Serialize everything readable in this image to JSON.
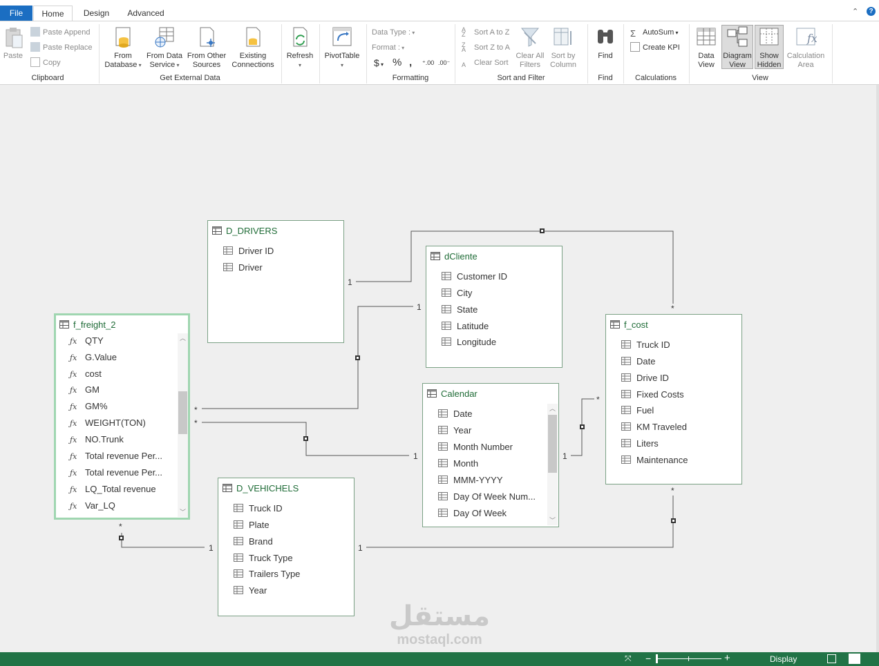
{
  "tabs": {
    "file": "File",
    "home": "Home",
    "design": "Design",
    "advanced": "Advanced"
  },
  "ribbon": {
    "clipboard": {
      "paste": "Paste",
      "paste_append": "Paste Append",
      "paste_replace": "Paste Replace",
      "copy": "Copy",
      "group": "Clipboard"
    },
    "external": {
      "from_database_1": "From",
      "from_database_2": "Database",
      "from_data_service_1": "From Data",
      "from_data_service_2": "Service",
      "from_other_1": "From Other",
      "from_other_2": "Sources",
      "existing_1": "Existing",
      "existing_2": "Connections",
      "group": "Get External Data"
    },
    "refresh": {
      "label": "Refresh"
    },
    "pivot": {
      "label": "PivotTable"
    },
    "formatting": {
      "data_type": "Data Type :",
      "format": "Format :",
      "dollar": "$",
      "percent": "%",
      "comma": "ͱ",
      "group": "Formatting"
    },
    "sort": {
      "sort_az": "Sort A to Z",
      "sort_za": "Sort Z to A",
      "clear_sort": "Clear Sort",
      "clear_filters_1": "Clear All",
      "clear_filters_2": "Filters",
      "sort_by_col_1": "Sort by",
      "sort_by_col_2": "Column",
      "group": "Sort and Filter"
    },
    "find": {
      "label": "Find",
      "group": "Find"
    },
    "calculations": {
      "autosum": "AutoSum",
      "create_kpi": "Create KPI",
      "group": "Calculations"
    },
    "view": {
      "data_view_1": "Data",
      "data_view_2": "View",
      "diagram_view_1": "Diagram",
      "diagram_view_2": "View",
      "show_hidden_1": "Show",
      "show_hidden_2": "Hidden",
      "calc_area_1": "Calculation",
      "calc_area_2": "Area",
      "group": "View"
    }
  },
  "tables": {
    "d_drivers": {
      "title": "D_DRIVERS",
      "fields": [
        "Driver ID",
        "Driver"
      ]
    },
    "dcliente": {
      "title": "dCliente",
      "fields": [
        "Customer ID",
        "City",
        "State",
        "Latitude",
        "Longitude"
      ]
    },
    "f_freight_2": {
      "title": "f_freight_2",
      "fields": [
        "QTY",
        "G.Value",
        "cost",
        "GM",
        "GM%",
        "WEIGHT(TON)",
        "NO.Trunk",
        "Total revenue Per...",
        "Total revenue Per...",
        "LQ_Total revenue",
        "Var_LQ"
      ]
    },
    "f_cost": {
      "title": "f_cost",
      "fields": [
        "Truck ID",
        "Date",
        "Drive ID",
        "Fixed Costs",
        "Fuel",
        "KM Traveled",
        "Liters",
        "Maintenance"
      ]
    },
    "calendar": {
      "title": "Calendar",
      "fields": [
        "Date",
        "Year",
        "Month Number",
        "Month",
        "MMM-YYYY",
        "Day Of Week Num...",
        "Day Of Week"
      ]
    },
    "d_vehichels": {
      "title": "D_VEHICHELS",
      "fields": [
        "Truck ID",
        "Plate",
        "Brand",
        "Truck Type",
        "Trailers Type",
        "Year"
      ]
    }
  },
  "cardinality": {
    "one": "1",
    "many": "*"
  },
  "watermark": {
    "arabic": "مستقل",
    "latin": "mostaql.com"
  },
  "status": {
    "display": "Display"
  }
}
